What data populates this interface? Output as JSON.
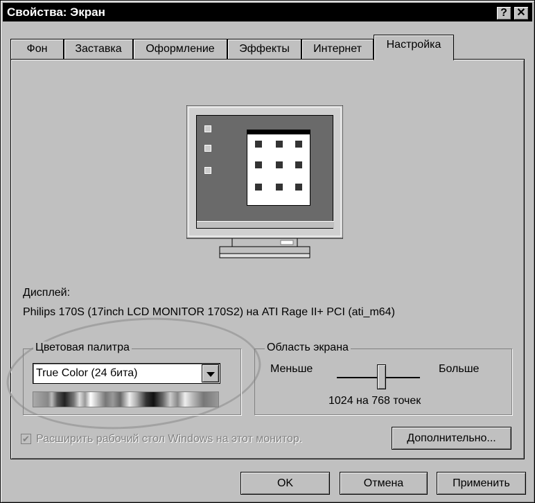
{
  "window": {
    "title": "Свойства: Экран",
    "help_label": "?",
    "close_label": "✕"
  },
  "tabs": [
    "Фон",
    "Заставка",
    "Оформление",
    "Эффекты",
    "Интернет",
    "Настройка"
  ],
  "display": {
    "label": "Дисплей:",
    "value": "Philips 170S (17inch LCD MONITOR 170S2) на ATI Rage II+ PCI (ati_m64)"
  },
  "color_palette": {
    "label": "Цветовая палитра",
    "selected": "True Color (24 бита)"
  },
  "screen_area": {
    "label": "Область экрана",
    "less": "Меньше",
    "more": "Больше",
    "value": "1024 на 768 точек",
    "level": 0.55
  },
  "extend_desktop": {
    "label": "Расширить рабочий стол Windows на этот монитор.",
    "checked": true,
    "enabled": false
  },
  "buttons": {
    "advanced": "Дополнительно...",
    "ok": "OK",
    "cancel": "Отмена",
    "apply": "Применить"
  }
}
